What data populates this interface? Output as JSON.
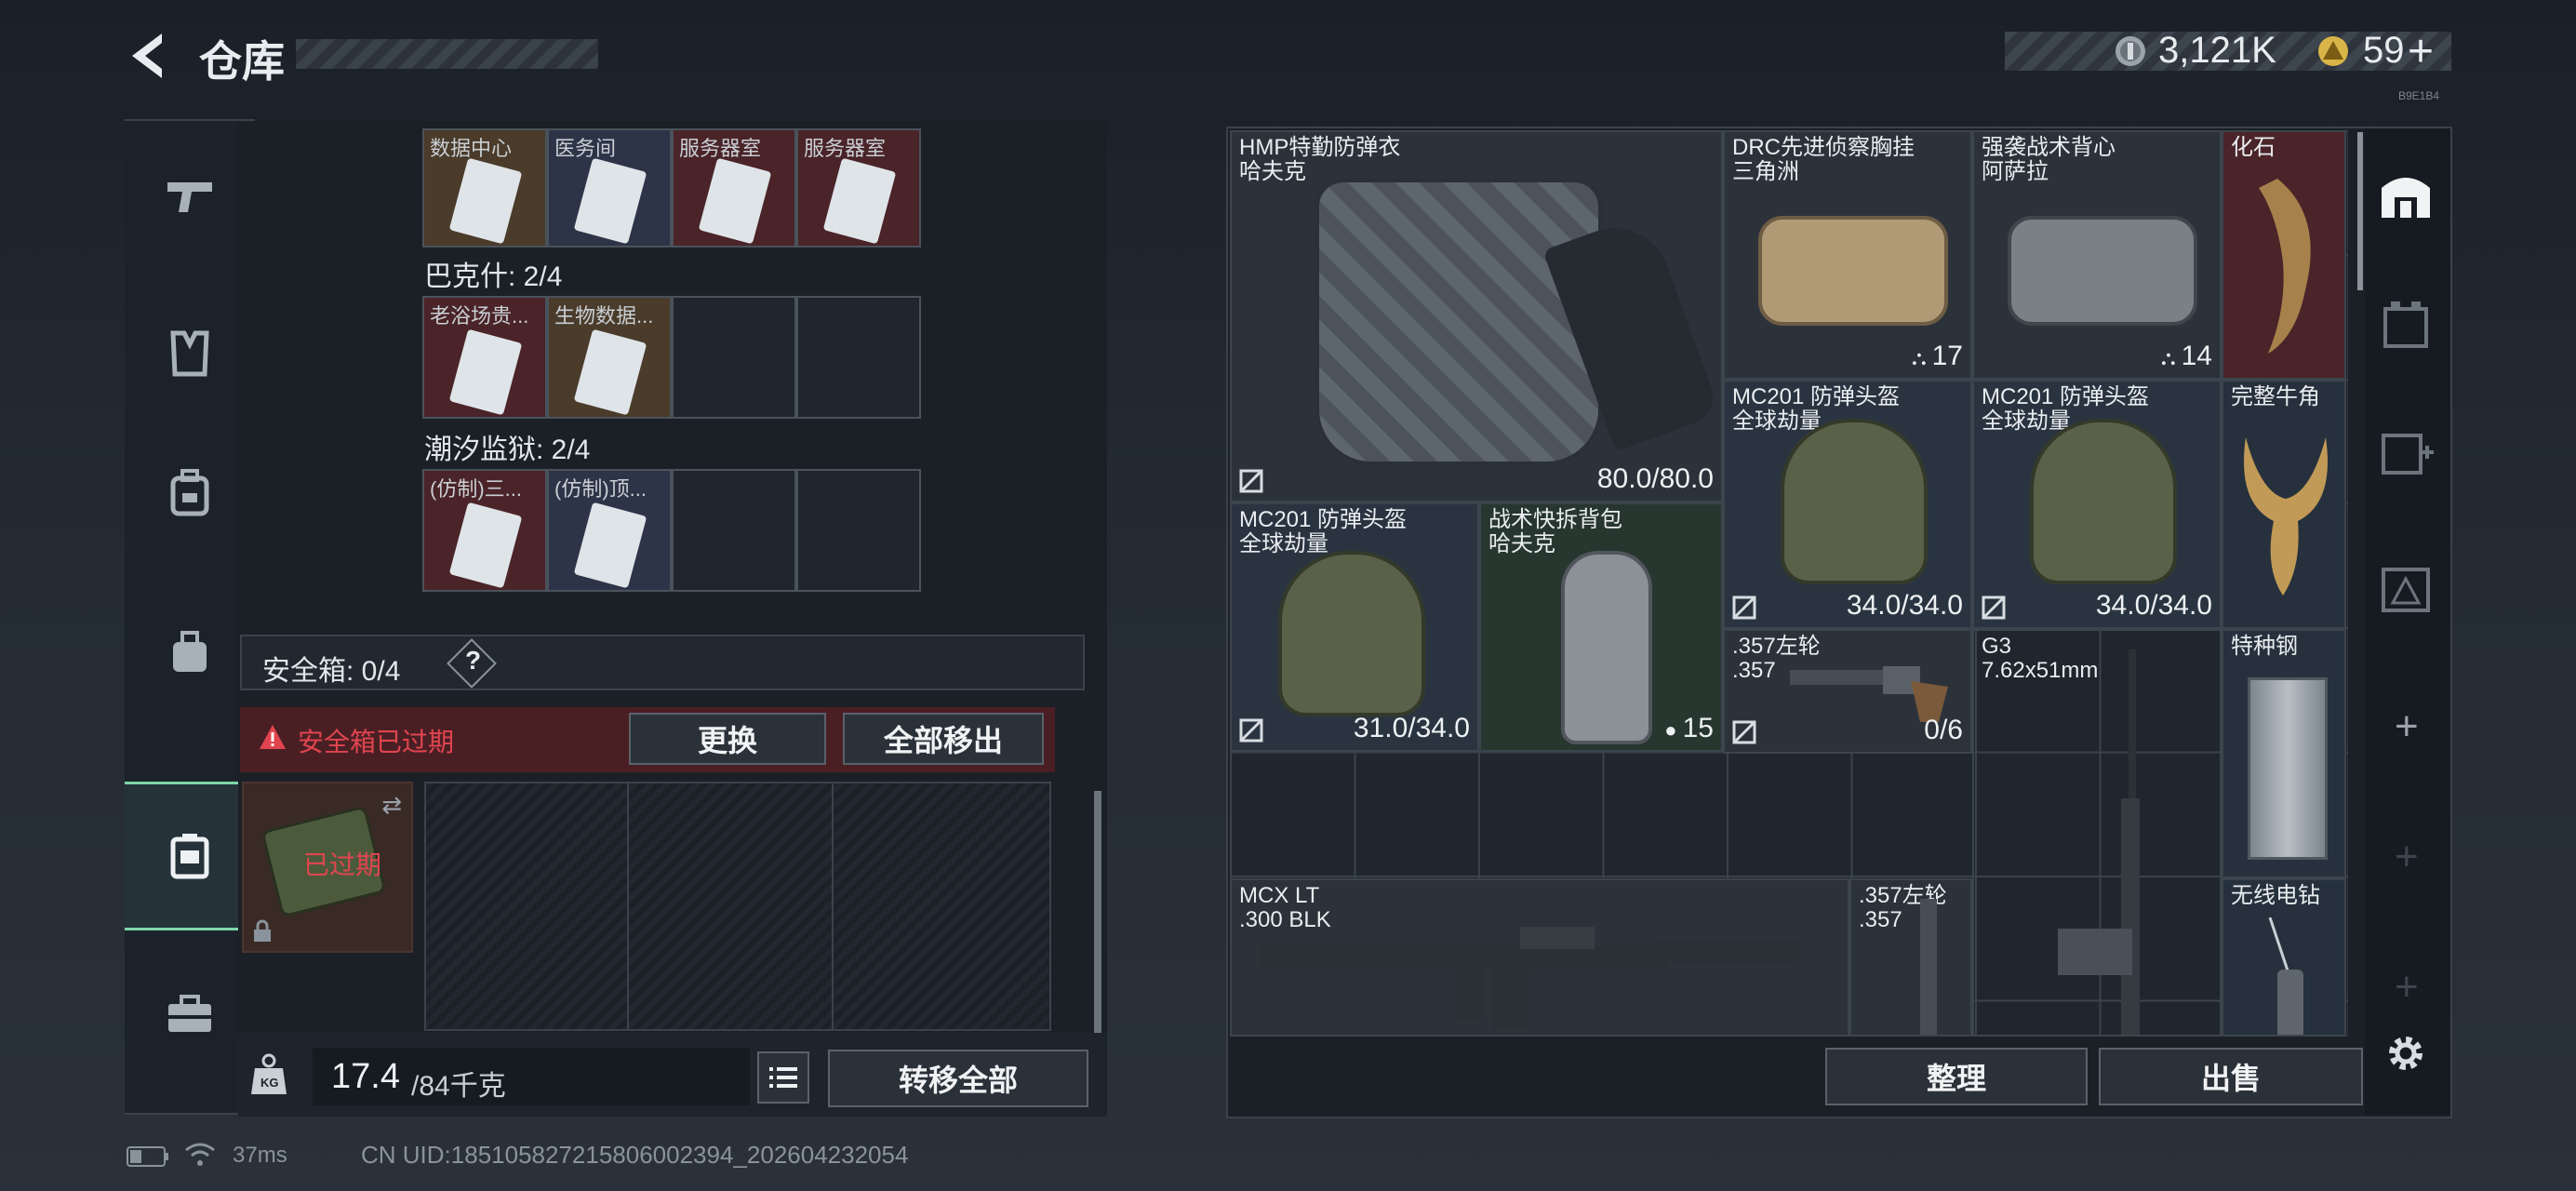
{
  "header": {
    "title": "仓库",
    "currency_amount": "3,121K",
    "premium_amount": "59",
    "premium_add": "+",
    "version_text": "B9E1B4"
  },
  "left_nav": {
    "items": [
      {
        "icon": "gun-icon"
      },
      {
        "icon": "armor-icon"
      },
      {
        "icon": "backpack-icon"
      },
      {
        "icon": "bag-icon"
      },
      {
        "icon": "safe-case-icon",
        "active": true
      },
      {
        "icon": "toolbox-icon"
      }
    ]
  },
  "keycards": {
    "group1_cards": [
      "数据中心",
      "医务间",
      "服务器室",
      "服务器室"
    ],
    "group2_title": "巴克什: 2/4",
    "group2_cards": [
      "老浴场贵...",
      "生物数据...",
      "",
      ""
    ],
    "group3_title": "潮汐监狱: 2/4",
    "group3_cards": [
      "(仿制)三...",
      "(仿制)顶...",
      "",
      ""
    ]
  },
  "safe_box": {
    "label": "安全箱: 0/4",
    "help": "?",
    "expired_warning": "安全箱已过期",
    "replace_btn": "更换",
    "move_all_out_btn": "全部移出",
    "case_status": "已过期"
  },
  "weight": {
    "current": "17.4",
    "max": "/84千克",
    "kg_badge": "KG",
    "transfer_all_btn": "转移全部"
  },
  "status_bar": {
    "ping": "37ms",
    "uid": "CN UID:18510582721580600​2394_202604232054"
  },
  "inventory": {
    "items": [
      {
        "name": "HMP特勤防弹衣",
        "sub": "哈夫克",
        "value": "80.0/80.0"
      },
      {
        "name": "DRC先进侦察胸挂",
        "sub": "三角洲",
        "value": "17"
      },
      {
        "name": "强袭战术背心",
        "sub": "阿萨拉",
        "value": "14"
      },
      {
        "name": "化石",
        "sub": "",
        "value": ""
      },
      {
        "name": "MC201 防弹头盔",
        "sub": "全球劫量",
        "value": "34.0/34.0"
      },
      {
        "name": "MC201 防弹头盔",
        "sub": "全球劫量",
        "value": "34.0/34.0"
      },
      {
        "name": "完整牛角",
        "sub": "",
        "value": ""
      },
      {
        "name": "MC201 防弹头盔",
        "sub": "全球劫量",
        "value": "31.0/34.0"
      },
      {
        "name": "战术快拆背包",
        "sub": "哈夫克",
        "value": "15"
      },
      {
        "name": ".357左轮",
        "sub": ".357",
        "value": "0/6"
      },
      {
        "name": "G3",
        "sub": "7.62x51mm",
        "value": ""
      },
      {
        "name": "特种钢",
        "sub": "",
        "value": ""
      },
      {
        "name": "MCX LT",
        "sub": ".300 BLK",
        "value": ""
      },
      {
        "name": ".357左轮",
        "sub": ".357",
        "value": ""
      },
      {
        "name": "无线电钻",
        "sub": "",
        "value": ""
      }
    ],
    "organize_btn": "整理",
    "sell_btn": "出售"
  },
  "right_nav": {
    "icons": [
      "stash-icon",
      "storage-icon",
      "add-storage-icon",
      "warning-storage-icon",
      "plus-icon",
      "plus-icon",
      "plus-icon",
      "settings-icon"
    ]
  },
  "colors": {
    "accent_green": "#7fd6a8",
    "warning_red": "#e0454f",
    "panel_bg": "#1b2026"
  }
}
